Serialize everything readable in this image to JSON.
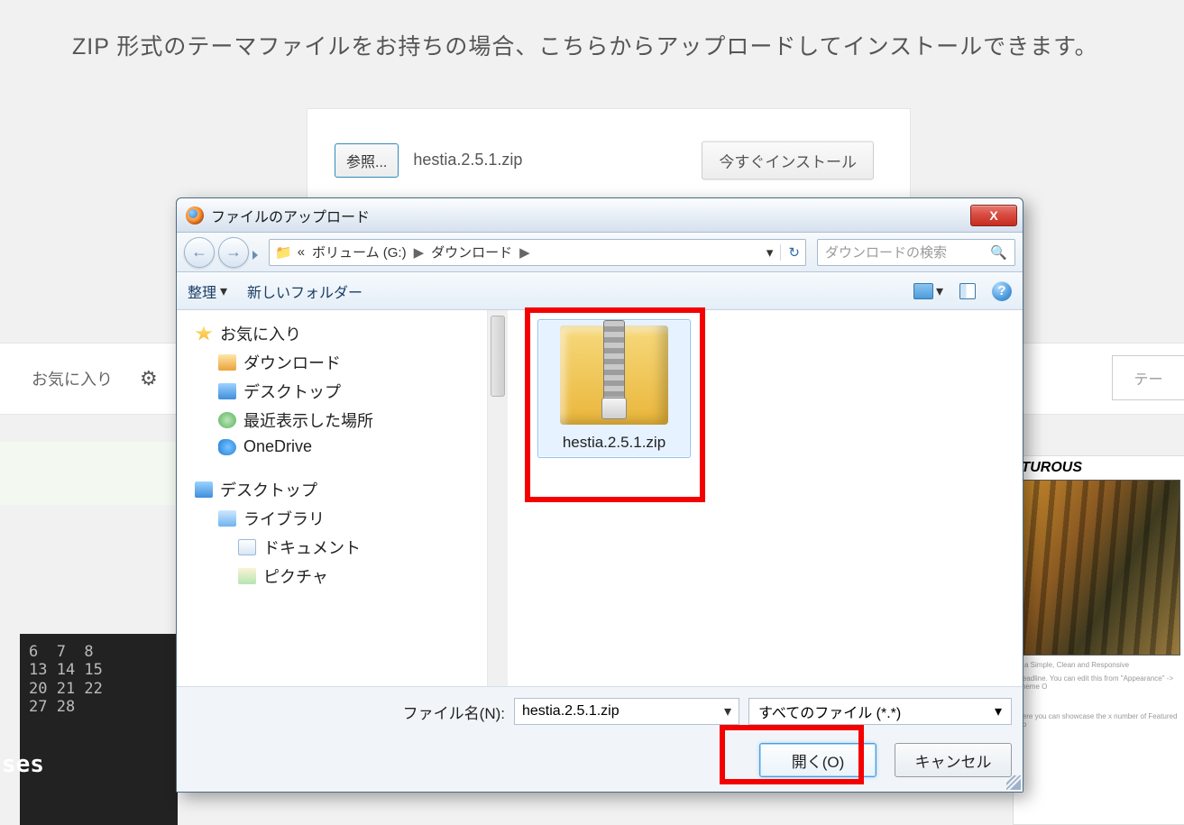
{
  "page": {
    "instruction": "ZIP 形式のテーマファイルをお持ちの場合、こちらからアップロードしてインストールできます。",
    "browse_label": "参照...",
    "selected_file": "hestia.2.5.1.zip",
    "install_label": "今すぐインストール",
    "favorites_label": "お気に入り",
    "right_tab_label": "テー",
    "dark_tile_numbers": "6  7  8\n13 14 15\n20 21 22\n27 28",
    "dark_tile_ses": "ses",
    "tiger": {
      "title": "ITUROUS",
      "line1": "is a Simple, Clean and Responsive",
      "line2": "Headline. You can edit this from \"Appearance\" -> Theme O",
      "line3": "Here you can showcase the x number of Featured Co"
    }
  },
  "dialog": {
    "title": "ファイルのアップロード",
    "close_label": "X",
    "breadcrumb": {
      "prefix": "«",
      "part1": "ボリューム (G:)",
      "part2": "ダウンロード"
    },
    "search_placeholder": "ダウンロードの検索",
    "toolbar": {
      "organize": "整理",
      "new_folder": "新しいフォルダー"
    },
    "tree": {
      "favorites": "お気に入り",
      "downloads": "ダウンロード",
      "desktop": "デスクトップ",
      "recent": "最近表示した場所",
      "onedrive": "OneDrive",
      "desktop2": "デスクトップ",
      "library": "ライブラリ",
      "documents": "ドキュメント",
      "pictures": "ピクチャ"
    },
    "file": {
      "name": "hestia.2.5.1.zip"
    },
    "footer": {
      "filename_label": "ファイル名(N):",
      "filename_value": "hestia.2.5.1.zip",
      "type_label": "すべてのファイル (*.*)",
      "open_label": "開く(O)",
      "cancel_label": "キャンセル"
    }
  }
}
